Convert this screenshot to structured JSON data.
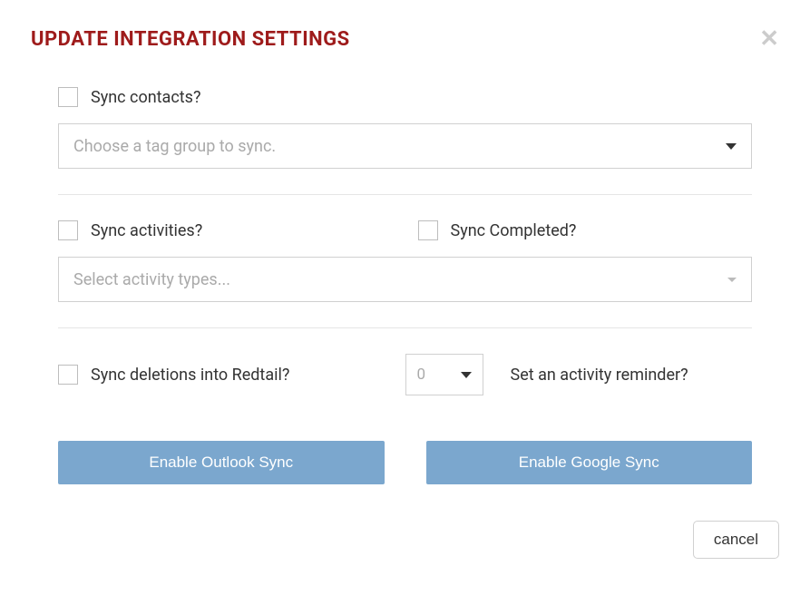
{
  "modal": {
    "title": "UPDATE INTEGRATION SETTINGS"
  },
  "contacts": {
    "checkbox_label": "Sync contacts?",
    "select_placeholder": "Choose a tag group to sync."
  },
  "activities": {
    "checkbox_label": "Sync activities?",
    "completed_label": "Sync Completed?",
    "select_placeholder": "Select activity types..."
  },
  "deletions": {
    "checkbox_label": "Sync deletions into Redtail?"
  },
  "reminder": {
    "value": "0",
    "label": "Set an activity reminder?"
  },
  "buttons": {
    "outlook": "Enable Outlook Sync",
    "google": "Enable Google Sync",
    "cancel": "cancel"
  }
}
